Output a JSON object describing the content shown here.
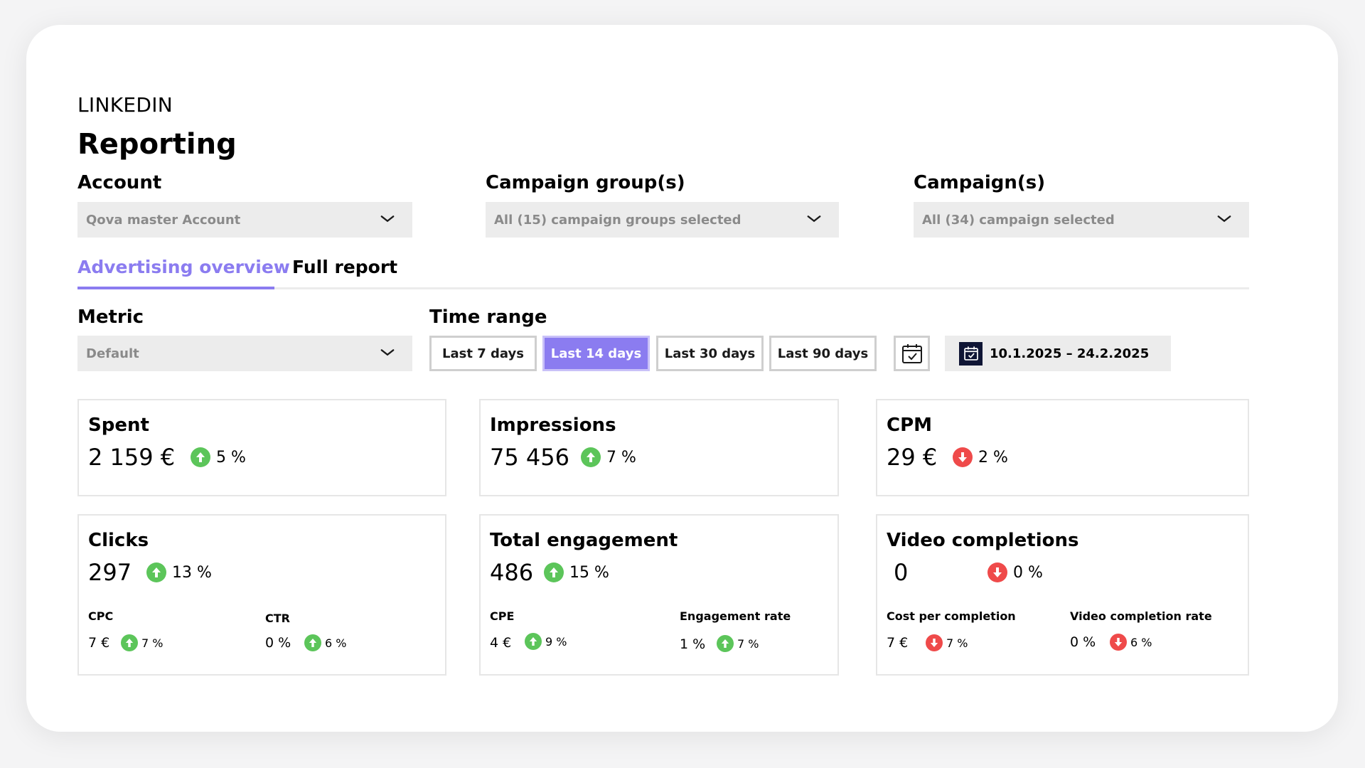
{
  "header": {
    "platform": "LINKEDIN",
    "title": "Reporting"
  },
  "filters": {
    "account": {
      "label": "Account",
      "value": "Qova master Account"
    },
    "campaign_groups": {
      "label": "Campaign group(s)",
      "value": "All (15) campaign groups selected"
    },
    "campaigns": {
      "label": "Campaign(s)",
      "value": "All (34) campaign selected"
    }
  },
  "tabs": [
    {
      "label": "Advertising overview",
      "active": true
    },
    {
      "label": "Full report",
      "active": false
    }
  ],
  "metric": {
    "label": "Metric",
    "value": "Default"
  },
  "time_range": {
    "label": "Time range",
    "options": [
      "Last 7 days",
      "Last 14 days",
      "Last 30 days",
      "Last 90 days"
    ],
    "selected": "Last 14 days",
    "date_range": "10.1.2025 – 24.2.2025"
  },
  "colors": {
    "accent": "#8b7cf0",
    "up": "#5cc55a",
    "down": "#ef4a4a"
  },
  "metrics": {
    "spent": {
      "title": "Spent",
      "value": "2 159 €",
      "change": "5 %",
      "trend": "up"
    },
    "impressions": {
      "title": "Impressions",
      "value": "75 456",
      "change": "7 %",
      "trend": "up"
    },
    "cpm": {
      "title": "CPM",
      "value": "29 €",
      "change": "2 %",
      "trend": "down"
    },
    "clicks": {
      "title": "Clicks",
      "value": "297",
      "change": "13 %",
      "trend": "up",
      "sub": [
        {
          "label": "CPC",
          "value": "7 €",
          "change": "7 %",
          "trend": "up"
        },
        {
          "label": "CTR",
          "value": "0 %",
          "change": "6 %",
          "trend": "up"
        }
      ]
    },
    "engagement": {
      "title": "Total engagement",
      "value": "486",
      "change": "15 %",
      "trend": "up",
      "sub": [
        {
          "label": "CPE",
          "value": "4 €",
          "change": "9 %",
          "trend": "up"
        },
        {
          "label": "Engagement rate",
          "value": "1 %",
          "change": "7 %",
          "trend": "up"
        }
      ]
    },
    "video": {
      "title": "Video completions",
      "value": "0",
      "change": "0 %",
      "trend": "down",
      "sub": [
        {
          "label": "Cost per completion",
          "value": "7 €",
          "change": "7 %",
          "trend": "down"
        },
        {
          "label": "Video completion rate",
          "value": "0 %",
          "change": "6 %",
          "trend": "down"
        }
      ]
    }
  }
}
